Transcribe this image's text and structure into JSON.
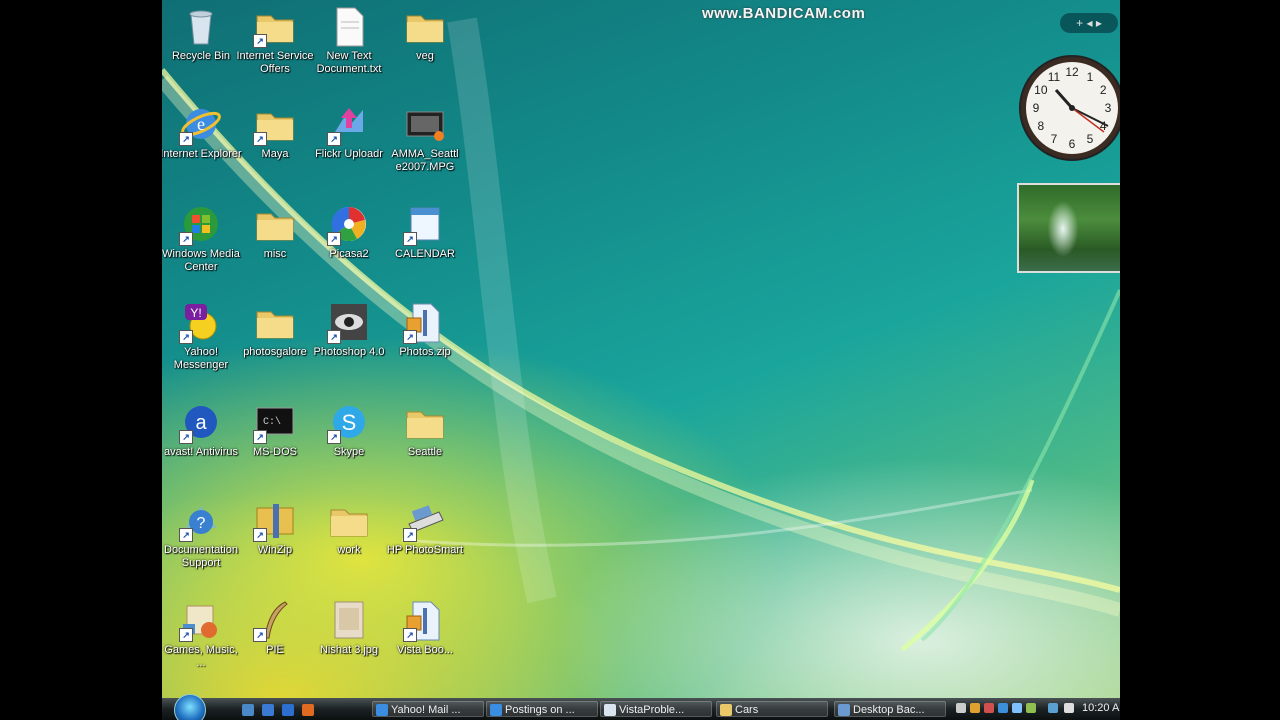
{
  "watermark": "www.BANDICAM.com",
  "desktop": {
    "icons": [
      {
        "label": "Recycle Bin",
        "icon": "recycle-bin-icon",
        "shortcut": false
      },
      {
        "label": "Internet Service Offers",
        "icon": "folder-icon",
        "shortcut": true
      },
      {
        "label": "New Text Document.txt",
        "icon": "text-file-icon",
        "shortcut": false
      },
      {
        "label": "veg",
        "icon": "folder-icon",
        "shortcut": false
      },
      {
        "label": "Internet Explorer",
        "icon": "ie-icon",
        "shortcut": true
      },
      {
        "label": "Maya",
        "icon": "folder-icon",
        "shortcut": true
      },
      {
        "label": "Flickr Uploadr",
        "icon": "flickr-icon",
        "shortcut": true
      },
      {
        "label": "AMMA_Seattl e2007.MPG",
        "icon": "video-file-icon",
        "shortcut": false
      },
      {
        "label": "Windows Media Center",
        "icon": "windows-logo-icon",
        "shortcut": true
      },
      {
        "label": "misc",
        "icon": "folder-icon",
        "shortcut": false
      },
      {
        "label": "Picasa2",
        "icon": "picasa-icon",
        "shortcut": true
      },
      {
        "label": "CALENDAR",
        "icon": "calendar-icon",
        "shortcut": true
      },
      {
        "label": "Yahoo! Messenger",
        "icon": "yahoo-messenger-icon",
        "shortcut": true
      },
      {
        "label": "photosgalore",
        "icon": "folder-icon",
        "shortcut": false
      },
      {
        "label": "Photoshop 4.0",
        "icon": "photoshop-eye-icon",
        "shortcut": true
      },
      {
        "label": "Photos.zip",
        "icon": "zip-file-icon",
        "shortcut": true
      },
      {
        "label": "avast! Antivirus",
        "icon": "avast-icon",
        "shortcut": true
      },
      {
        "label": "MS-DOS",
        "icon": "terminal-icon",
        "shortcut": true
      },
      {
        "label": "Skype",
        "icon": "skype-icon",
        "shortcut": true
      },
      {
        "label": "Seattle",
        "icon": "folder-icon",
        "shortcut": false
      },
      {
        "label": "Documentation Support",
        "icon": "help-icon",
        "shortcut": true
      },
      {
        "label": "WinZip",
        "icon": "winzip-icon",
        "shortcut": true
      },
      {
        "label": "work",
        "icon": "folder-icon",
        "shortcut": false
      },
      {
        "label": "HP PhotoSmart",
        "icon": "scanner-icon",
        "shortcut": true
      },
      {
        "label": "Games, Music, ...",
        "icon": "games-icon",
        "shortcut": true
      },
      {
        "label": "PIE",
        "icon": "quill-icon",
        "shortcut": true
      },
      {
        "label": "Nishat 3.jpg",
        "icon": "image-file-icon",
        "shortcut": false
      },
      {
        "label": "Vista Boo...",
        "icon": "zip-file-icon",
        "shortcut": true
      }
    ]
  },
  "gadgets": {
    "clock_numbers": [
      "12",
      "1",
      "2",
      "3",
      "4",
      "5",
      "6",
      "7",
      "8",
      "9",
      "10",
      "11"
    ],
    "sidebar_control": "+ ◂ ▸"
  },
  "taskbar": {
    "tasks": [
      {
        "label": "Yahoo! Mail ...",
        "icon": "ie-icon"
      },
      {
        "label": "Postings on ...",
        "icon": "ie-icon"
      },
      {
        "label": "VistaProble...",
        "icon": "document-icon"
      },
      {
        "label": "Cars",
        "icon": "folder-icon"
      },
      {
        "label": "Desktop Bac...",
        "icon": "display-icon"
      }
    ],
    "time": "10:20 A"
  }
}
